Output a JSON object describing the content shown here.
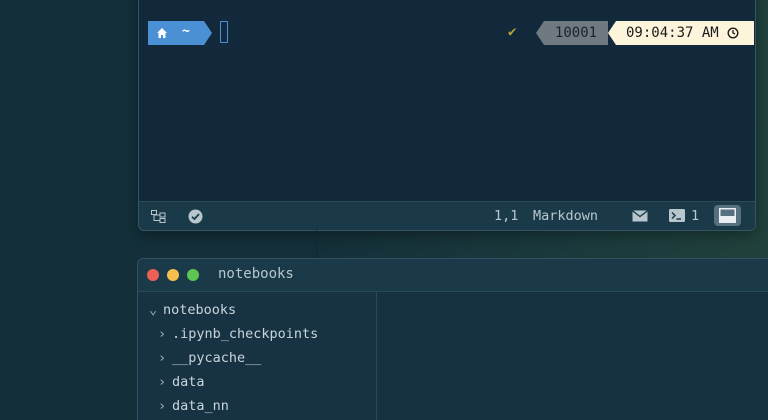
{
  "terminal": {
    "prompt": {
      "home_icon": "home-icon",
      "dir": "~",
      "status_check": "✔",
      "history_number": "10001",
      "time": "09:04:37 AM",
      "clock_icon": "clock-icon"
    },
    "statusbar": {
      "tree_icon": "tree-icon",
      "check_icon": "check-circle-icon",
      "cursor_pos": "1,1",
      "language": "Markdown",
      "mail_icon": "mail-icon",
      "terminal_icon": "terminal-icon",
      "terminal_count": "1",
      "panel_icon": "panel-bottom-icon"
    }
  },
  "notebooks_window": {
    "title": "notebooks",
    "traffic_lights": {
      "close": "#ee5f58",
      "minimize": "#f5bf4f",
      "maximize": "#5fc552"
    },
    "tree": {
      "root": {
        "label": "notebooks",
        "expanded": true
      },
      "children": [
        {
          "label": ".ipynb_checkpoints"
        },
        {
          "label": "__pycache__"
        },
        {
          "label": "data"
        },
        {
          "label": "data_nn"
        }
      ]
    }
  },
  "colors": {
    "prompt_home_bg": "#4b8fd4",
    "prompt_code_bg": "#6e7980",
    "prompt_time_bg": "#fdf4dc",
    "check_color": "#b6a43a",
    "window_bg": "#11293a",
    "statusbar_bg": "#1b3a49"
  }
}
